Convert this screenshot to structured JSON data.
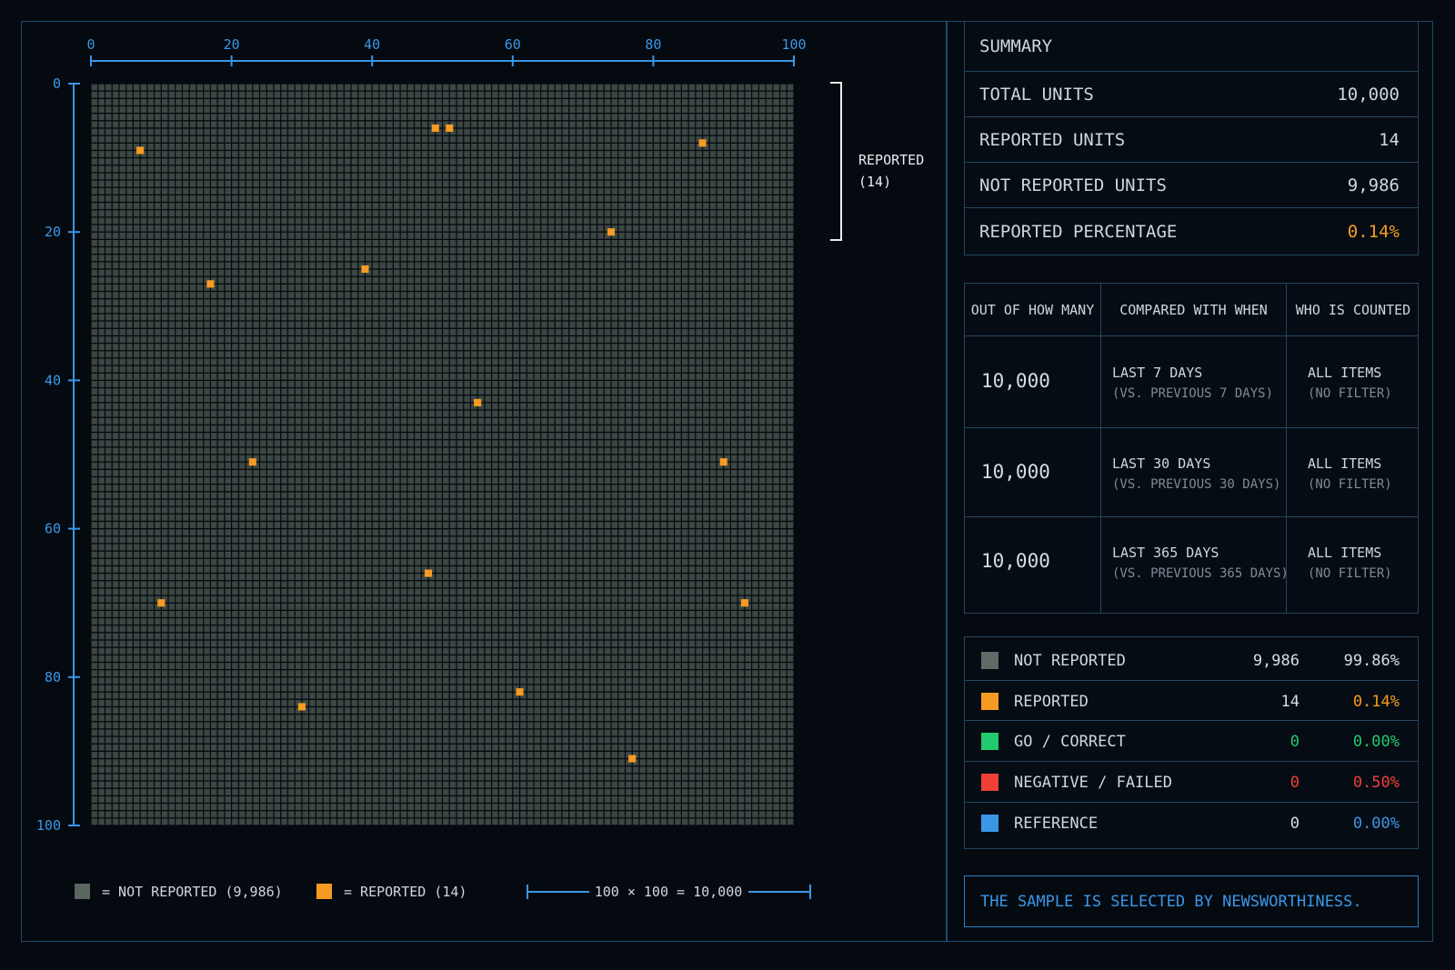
{
  "chart_data": {
    "type": "heatmap",
    "grid": {
      "cols": 100,
      "rows": 100
    },
    "x_ticks": [
      "0",
      "20",
      "40",
      "60",
      "80",
      "100"
    ],
    "y_ticks": [
      "0",
      "20",
      "40",
      "60",
      "80",
      "100"
    ],
    "xlim": [
      0,
      100
    ],
    "ylim": [
      0,
      100
    ],
    "reported_points": [
      {
        "x": 7,
        "y": 9
      },
      {
        "x": 49,
        "y": 6
      },
      {
        "x": 51,
        "y": 6
      },
      {
        "x": 87,
        "y": 8
      },
      {
        "x": 74,
        "y": 20
      },
      {
        "x": 39,
        "y": 25
      },
      {
        "x": 17,
        "y": 27
      },
      {
        "x": 55,
        "y": 43
      },
      {
        "x": 23,
        "y": 51
      },
      {
        "x": 90,
        "y": 51
      },
      {
        "x": 48,
        "y": 66
      },
      {
        "x": 10,
        "y": 70
      },
      {
        "x": 93,
        "y": 70
      },
      {
        "x": 61,
        "y": 82
      },
      {
        "x": 30,
        "y": 84
      },
      {
        "x": 77,
        "y": 91
      }
    ],
    "colors": {
      "not_reported": "#3c4642",
      "reported": "#f59b23",
      "axis": "#3a97e8"
    },
    "bracket_label": [
      "REPORTED",
      "(14)"
    ],
    "legend": [
      {
        "swatch": "#5a6660",
        "label": "= NOT REPORTED (9,986)"
      },
      {
        "swatch": "#f59b23",
        "label": "= REPORTED (14)"
      }
    ],
    "scale_label": "100 × 100 = 10,000"
  },
  "summary": {
    "title": "SUMMARY",
    "rows": [
      {
        "label": "TOTAL UNITS",
        "value": "10,000"
      },
      {
        "label": "REPORTED UNITS",
        "value": "14"
      },
      {
        "label": "NOT REPORTED UNITS",
        "value": "9,986"
      },
      {
        "label": "REPORTED PERCENTAGE",
        "value": "0.14%"
      }
    ]
  },
  "context_table": {
    "headers": [
      "OUT OF HOW MANY",
      "COMPARED WITH WHEN",
      "WHO IS COUNTED"
    ],
    "rows": [
      {
        "count": "10,000",
        "when": "LAST 7 DAYS",
        "when_sub": "(VS. PREVIOUS 7 DAYS)",
        "who": "ALL ITEMS",
        "who_sub": "(NO FILTER)"
      },
      {
        "count": "10,000",
        "when": "LAST 30 DAYS",
        "when_sub": "(VS. PREVIOUS 30 DAYS)",
        "who": "ALL ITEMS",
        "who_sub": "(NO FILTER)"
      },
      {
        "count": "10,000",
        "when": "LAST 365 DAYS",
        "when_sub": "(VS. PREVIOUS 365 DAYS)",
        "who": "ALL ITEMS",
        "who_sub": "(NO FILTER)"
      }
    ]
  },
  "breakdown": [
    {
      "color": "#5f6b66",
      "label": "NOT REPORTED",
      "count": "9,986",
      "pct": "99.86%",
      "tone": "plain"
    },
    {
      "color": "#f59b23",
      "label": "REPORTED",
      "count": "14",
      "pct": "0.14%",
      "tone": "orange"
    },
    {
      "color": "#22c96e",
      "label": "GO / CORRECT",
      "count": "0",
      "pct": "0.00%",
      "tone": "green"
    },
    {
      "color": "#ef4035",
      "label": "NEGATIVE / FAILED",
      "count": "0",
      "pct": "0.50%",
      "tone": "red"
    },
    {
      "color": "#3a97e8",
      "label": "REFERENCE",
      "count": "0",
      "pct": "0.00%",
      "tone": "blue"
    }
  ],
  "note": "THE SAMPLE IS SELECTED BY NEWSWORTHINESS."
}
